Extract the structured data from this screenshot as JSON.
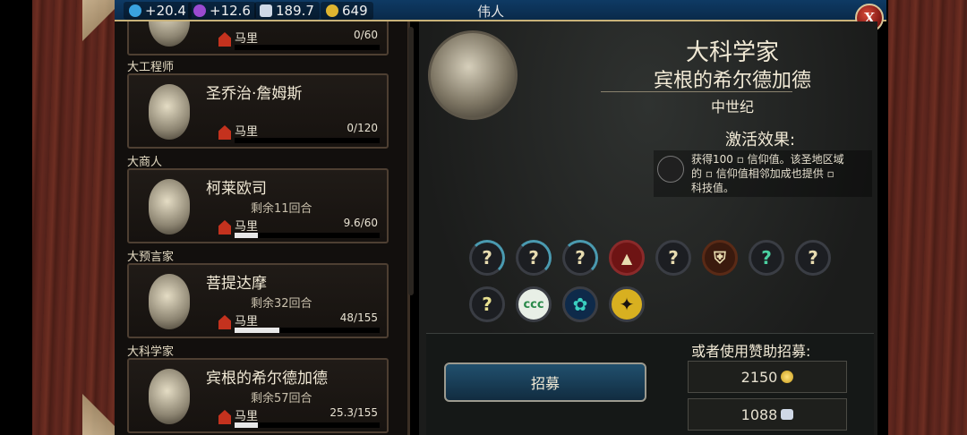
{
  "top_bar": {
    "science": "+20.4",
    "culture": "+12.6",
    "faith": "189.7",
    "gold": "649",
    "title": "伟人",
    "close_label": "X"
  },
  "list": {
    "cards": [
      {
        "category": "",
        "name": "",
        "turns": "",
        "city": "马里",
        "progress": "0/60",
        "fill": 0
      },
      {
        "category": "大工程师",
        "name": "圣乔治·詹姆斯",
        "turns": "",
        "city": "马里",
        "progress": "0/120",
        "fill": 0
      },
      {
        "category": "大商人",
        "name": "柯莱欧司",
        "turns": "剩余11回合",
        "city": "马里",
        "progress": "9.6/60",
        "fill": 0.16
      },
      {
        "category": "大预言家",
        "name": "菩提达摩",
        "turns": "剩余32回合",
        "city": "马里",
        "progress": "48/155",
        "fill": 0.31
      },
      {
        "category": "大科学家",
        "name": "宾根的希尔德加德",
        "turns": "剩余57回合",
        "city": "马里",
        "progress": "25.3/155",
        "fill": 0.16
      }
    ]
  },
  "detail": {
    "type": "大科学家",
    "name": "宾根的希尔德加德",
    "era": "中世纪",
    "effect_heading": "激活效果:",
    "effect_line1": "获得100 ▫ 信仰值。该圣地区域",
    "effect_line2": "的 ▫ 信仰值相邻加成也提供 ▫",
    "effect_line3": "科技值。",
    "slots_row1": [
      "?",
      "?",
      "?",
      "city",
      "?",
      "shield",
      "?",
      "?"
    ],
    "slots_row2": [
      "?",
      "ccc",
      "lotus",
      "eagle"
    ],
    "recruit_label": "招募",
    "or_label": "或者使用赞助招募:",
    "gold_cost": "2150",
    "faith_cost": "1088"
  },
  "colors": {
    "accent_teal": "#4a9ab0",
    "gold": "#e0b530",
    "button_blue": "#21506e"
  }
}
